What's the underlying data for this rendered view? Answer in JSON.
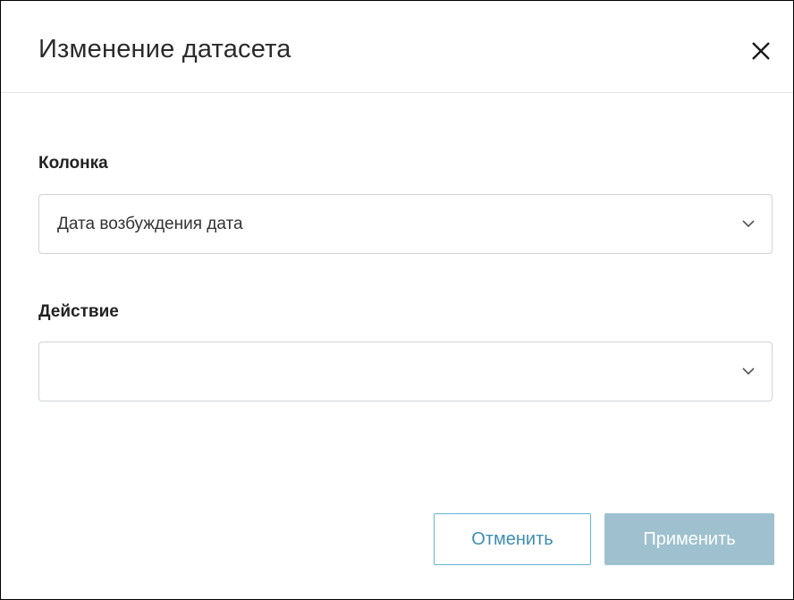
{
  "dialog": {
    "title": "Изменение датасета",
    "close_icon": "close-icon"
  },
  "fields": [
    {
      "label": "Колонка",
      "value": "Дата возбуждения дата",
      "icon": "chevron-down-icon"
    },
    {
      "label": "Действие",
      "value": "",
      "icon": "chevron-down-icon"
    }
  ],
  "buttons": {
    "cancel_label": "Отменить",
    "apply_label": "Применить"
  },
  "colors": {
    "cancel_border": "#5fb5d8",
    "cancel_text": "#3f8db3",
    "apply_background": "#9fc1cf",
    "apply_text": "#ffffff"
  }
}
